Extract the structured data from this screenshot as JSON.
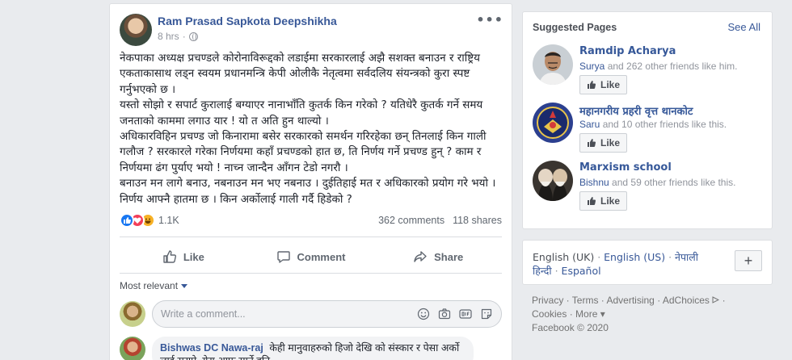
{
  "post": {
    "author": "Ram Prasad Sapkota Deepshikha",
    "time": "8 hrs",
    "more": "•••",
    "text": "नेकपाका अध्यक्ष प्रचण्डले कोरोनाविरूद्दको लडाईमा सरकारलाई अझै सशक्त बनाउन र राष्ट्रिय एकताकासाथ लड्न स्वयम प्रधानमन्त्रि केपी ओलीकै नेतृत्वमा सर्वदलिय संयन्त्रको कुरा स्पष्ट गर्नुभएको छ ।\nयस्तो सोझो र सपार्ट कुरालाई बग्याएर नानाभाँति कुतर्क किन गरेको ? यतिधेरै कुतर्क गर्ने समय जनताको काममा लगाउ यार ! यो त अति हुन थाल्यो ।\nअधिकारविहिन प्रचण्ड जो किनारामा बसेर सरकारको समर्थन गरिरहेका छन् तिनलाई किन गाली गलौज ? सरकारले गरेका निर्णयमा कहाँ प्रचण्डको हात छ, ति निर्णय गर्ने प्रचण्ड हुन् ? काम र निर्णयमा ढंग पुर्याए भयो ! नाच्न जान्दैन आँगन टेडो नगरौ ।\nबनाउन मन लागे बनाउ, नबनाउन मन भए नबनाउ । दुईतिहाई मत र अधिकारको प्रयोग गरे भयो । निर्णय आफ्नै हातमा छ । किन अर्कोलाई गाली गर्दै हिडेको ?",
    "reaction_count": "1.1K",
    "comments": "362 comments",
    "shares": "118 shares",
    "actions": {
      "like": "Like",
      "comment": "Comment",
      "share": "Share"
    },
    "sort": "Most relevant",
    "comment_placeholder": "Write a comment...",
    "first_comment": {
      "name": "Bishwas DC Nawa-raj",
      "text": "केही मानुवाहरुको हिजो देखि को संस्कार र पेसा अर्को लाई सराप्ने ,येरा आफु सार्ने हुनि"
    }
  },
  "suggested": {
    "title": "Suggested Pages",
    "see_all": "See All",
    "like_label": "Like",
    "items": [
      {
        "name": "Ramdip Acharya",
        "friend": "Surya",
        "rest": "and 262 other friends like him."
      },
      {
        "name": "महानगरीय प्रहरी वृत्त थानकोट",
        "friend": "Saru",
        "rest": "and 10 other friends like this."
      },
      {
        "name": "Marxism school",
        "friend": "Bishnu",
        "rest": "and 59 other friends like this."
      }
    ]
  },
  "languages": {
    "current": "English (UK)",
    "others": [
      "English (US)",
      "नेपाली",
      "हिन्दी",
      "Español"
    ],
    "plus": "+"
  },
  "footer": {
    "links": [
      "Privacy",
      "Terms",
      "Advertising",
      "AdChoices",
      "Cookies",
      "More"
    ],
    "more_caret": "▾",
    "copyright": "Facebook © 2020"
  },
  "colors": {
    "link": "#385898",
    "like_blue": "#1877f2",
    "love": "#f33e58",
    "haha": "#f7b125",
    "bg": "#e9ebee"
  }
}
